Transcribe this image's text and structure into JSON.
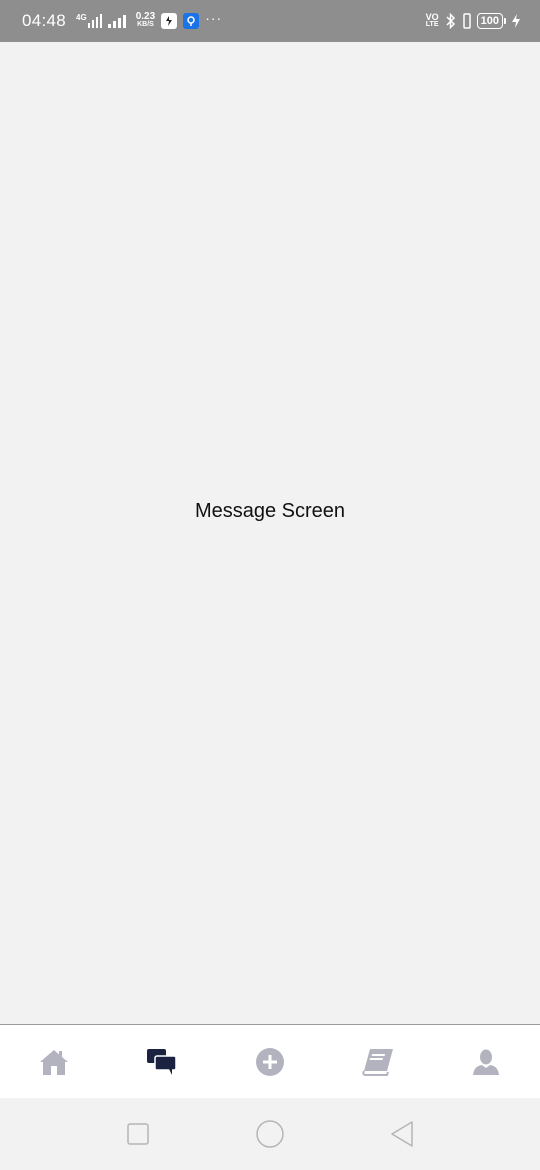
{
  "status_bar": {
    "time": "04:48",
    "net_4g": "4G",
    "netspeed_value": "0.23",
    "netspeed_unit": "KB/S",
    "overflow": "···",
    "volte_top": "VO",
    "volte_bottom": "LTE",
    "battery": "100"
  },
  "content": {
    "label": "Message Screen"
  },
  "tabs": [
    {
      "name": "home",
      "icon": "home-icon",
      "active": false
    },
    {
      "name": "messages",
      "icon": "chat-icon",
      "active": true
    },
    {
      "name": "add",
      "icon": "plus-circle-icon",
      "active": false
    },
    {
      "name": "library",
      "icon": "book-icon",
      "active": false
    },
    {
      "name": "profile",
      "icon": "user-icon",
      "active": false
    }
  ],
  "colors": {
    "active_tab": "#1c2340",
    "inactive_tab": "#b3b3bf",
    "status_bar_bg": "#8e8e8e"
  }
}
